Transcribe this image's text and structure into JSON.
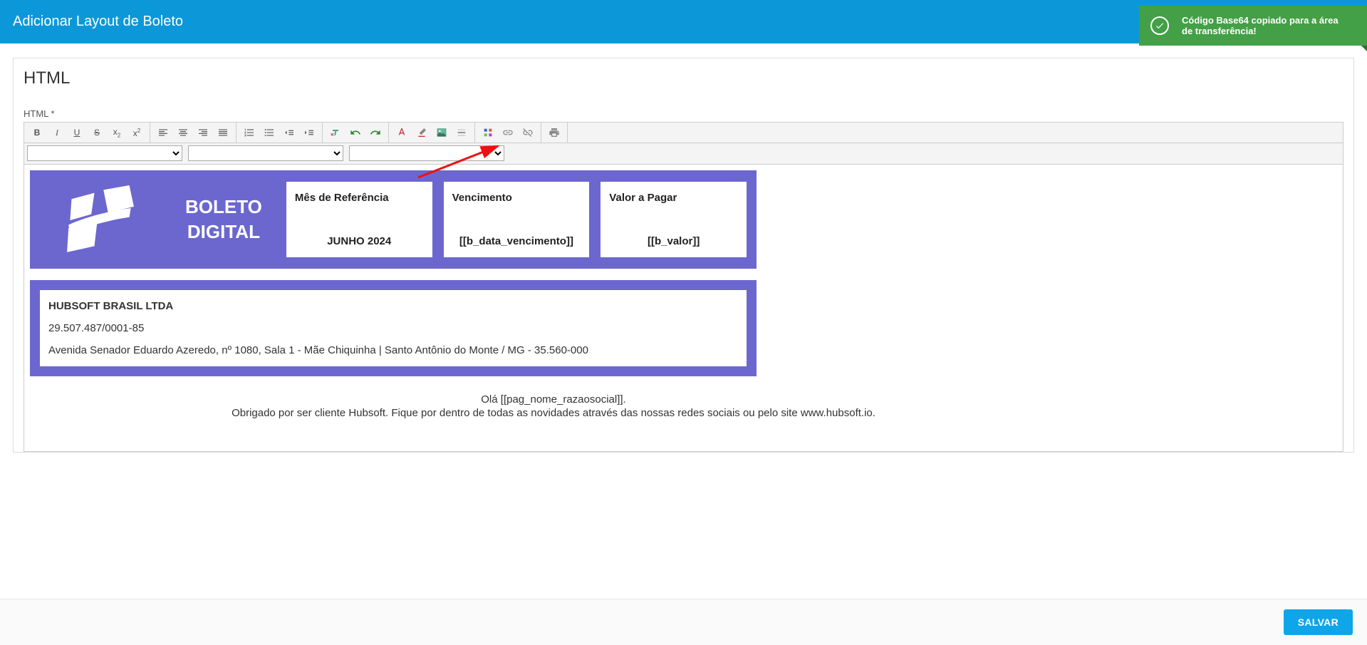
{
  "header": {
    "title": "Adicionar Layout de Boleto"
  },
  "toast": {
    "message": "Código Base64 copiado para a área de transferência!"
  },
  "panel": {
    "title": "HTML",
    "fieldLabel": "HTML *"
  },
  "boleto": {
    "titleLine1": "BOLETO",
    "titleLine2": "DIGITAL",
    "card1": {
      "label": "Mês de Referência",
      "value": "JUNHO 2024"
    },
    "card2": {
      "label": "Vencimento",
      "value": "[[b_data_vencimento]]"
    },
    "card3": {
      "label": "Valor a Pagar",
      "value": "[[b_valor]]"
    }
  },
  "company": {
    "name": "HUBSOFT BRASIL LTDA",
    "cnpj": "29.507.487/0001-85",
    "address": "Avenida Senador Eduardo Azeredo, nº 1080, Sala 1 - Mãe Chiquinha | Santo Antônio do Monte / MG - 35.560-000"
  },
  "greeting": {
    "line1": "Olá [[pag_nome_razaosocial]].",
    "line2": "Obrigado por ser cliente Hubsoft. Fique por dentro de todas as novidades através das nossas redes sociais ou pelo site www.hubsoft.io."
  },
  "footer": {
    "saveLabel": "SALVAR"
  }
}
